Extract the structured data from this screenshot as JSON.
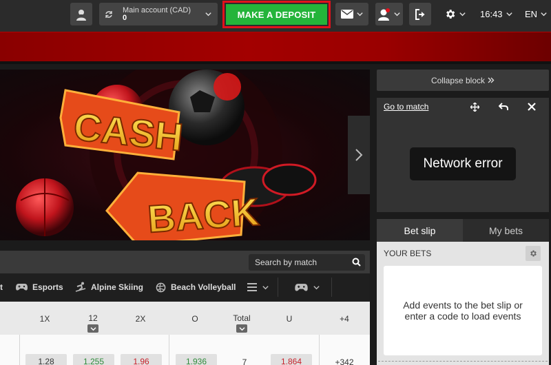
{
  "header": {
    "account": {
      "label": "Main account (CAD)",
      "balance": "0"
    },
    "deposit_label": "MAKE A DEPOSIT",
    "time": "16:43",
    "language": "EN"
  },
  "banner": {
    "line1": "CASH",
    "line2": "BACK"
  },
  "search": {
    "placeholder": "Search by match"
  },
  "sports_nav": {
    "items": [
      {
        "label": "t"
      },
      {
        "label": "Esports"
      },
      {
        "label": "Alpine Skiing"
      },
      {
        "label": "Beach Volleyball"
      }
    ]
  },
  "odds_table": {
    "headers": [
      "1X",
      "12",
      "2X",
      "O",
      "Total",
      "U",
      "+4"
    ],
    "row": {
      "values": [
        "1.28",
        "1.255",
        "1.96",
        "1.936",
        "7",
        "1.864",
        "+342"
      ]
    }
  },
  "right_panel": {
    "collapse_label": "Collapse block",
    "goto_match": "Go to match",
    "network_error": "Network error",
    "tabs": {
      "betslip": "Bet slip",
      "mybets": "My bets"
    },
    "your_bets": "YOUR BETS",
    "empty_message": "Add events to the bet slip or enter a code to load events"
  },
  "colors": {
    "deposit_green": "#24b43a",
    "deposit_outline": "#e4101c",
    "odd_up": "#2e8b3a",
    "odd_down": "#c8202a"
  }
}
